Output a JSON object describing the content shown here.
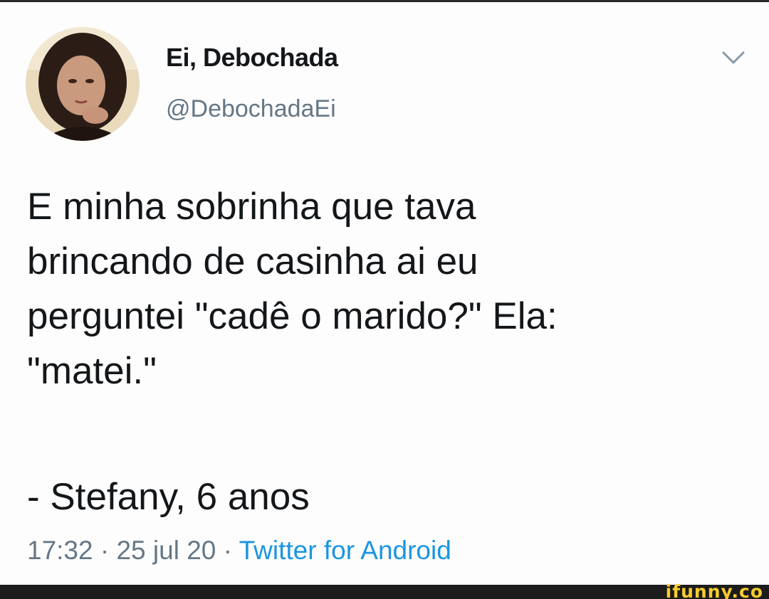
{
  "tweet": {
    "display_name": "Ei, Debochada",
    "handle": "@DebochadaEi",
    "text_lines": [
      "E minha sobrinha que tava",
      "brincando de casinha ai eu",
      "perguntei \"cadê o marido?\" Ela:",
      "\"matei.\""
    ],
    "signature": "- Stefany, 6 anos",
    "time": "17:32",
    "separator": "·",
    "date": "25 jul 20",
    "source": "Twitter for Android",
    "menu_icon": "chevron-down-icon",
    "avatar_icon": "avatar"
  },
  "watermark": {
    "text": "ifunny.co"
  },
  "colors": {
    "text": "#14171a",
    "secondary": "#657786",
    "link": "#1b95e0",
    "watermark": "#f7cc2d"
  }
}
